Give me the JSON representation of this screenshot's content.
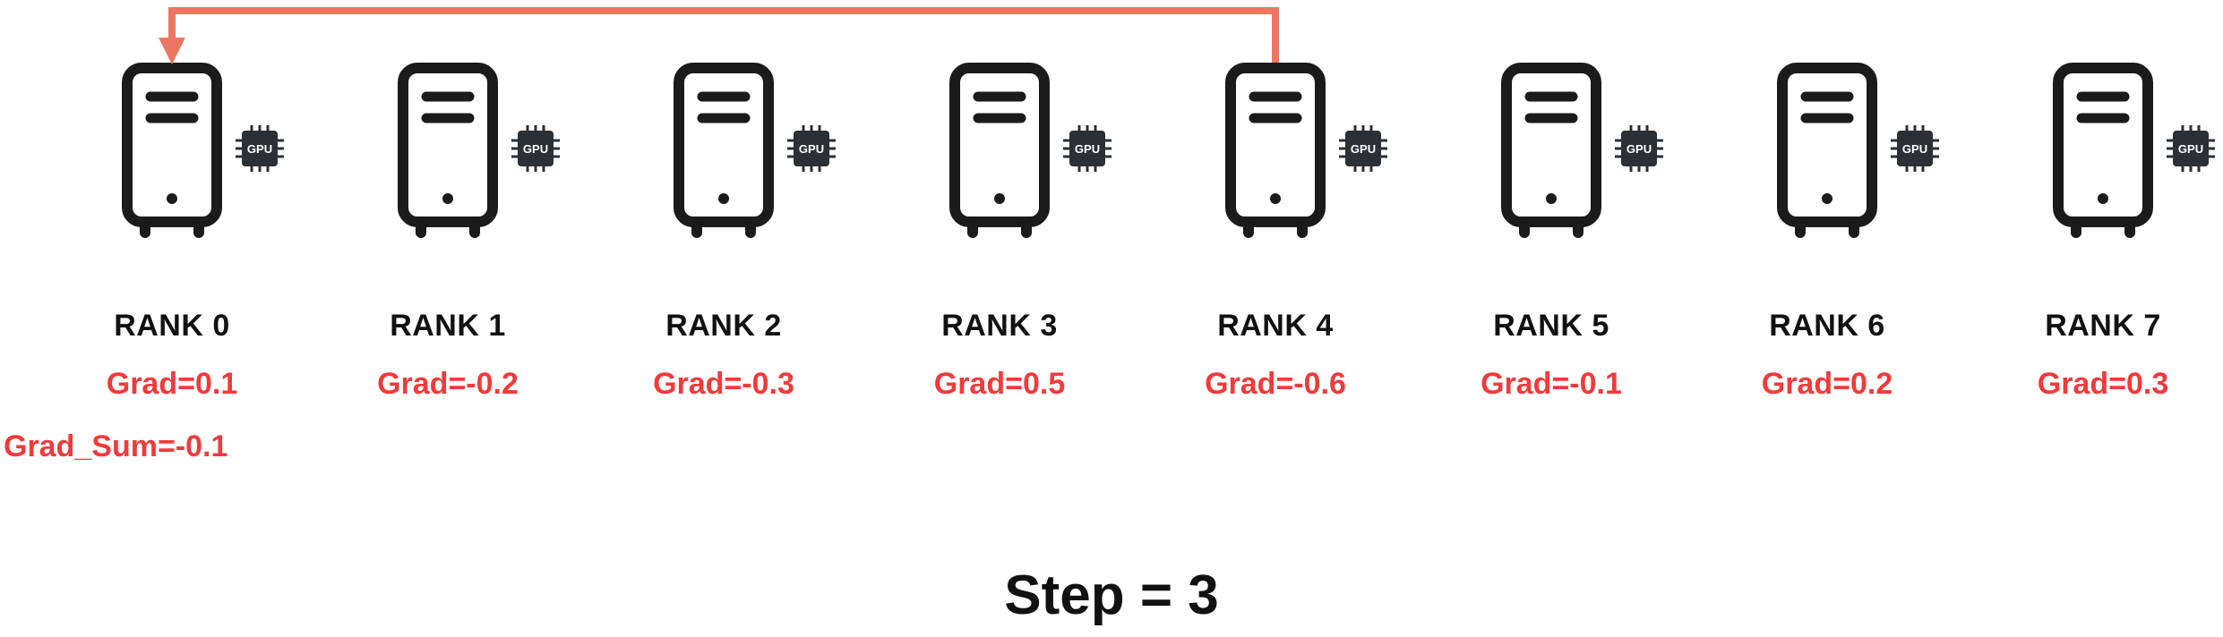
{
  "colors": {
    "accent": "#f23a3a",
    "arrow": "#ec7563",
    "icon": "#1b1b1b",
    "chip": "#2b2f36"
  },
  "icons": {
    "server": "server-icon",
    "gpu": "gpu-chip-icon"
  },
  "ranks": [
    {
      "label": "RANK 0",
      "grad": "Grad=0.1",
      "gpu_text": "GPU"
    },
    {
      "label": "RANK 1",
      "grad": "Grad=-0.2",
      "gpu_text": "GPU"
    },
    {
      "label": "RANK 2",
      "grad": "Grad=-0.3",
      "gpu_text": "GPU"
    },
    {
      "label": "RANK 3",
      "grad": "Grad=0.5",
      "gpu_text": "GPU"
    },
    {
      "label": "RANK 4",
      "grad": "Grad=-0.6",
      "gpu_text": "GPU"
    },
    {
      "label": "RANK 5",
      "grad": "Grad=-0.1",
      "gpu_text": "GPU"
    },
    {
      "label": "RANK 6",
      "grad": "Grad=0.2",
      "gpu_text": "GPU"
    },
    {
      "label": "RANK 7",
      "grad": "Grad=0.3",
      "gpu_text": "GPU"
    }
  ],
  "grad_sum": "Grad_Sum=-0.1",
  "transfer": {
    "from_rank": 4,
    "to_rank": 0
  },
  "step_label": "Step = 3"
}
